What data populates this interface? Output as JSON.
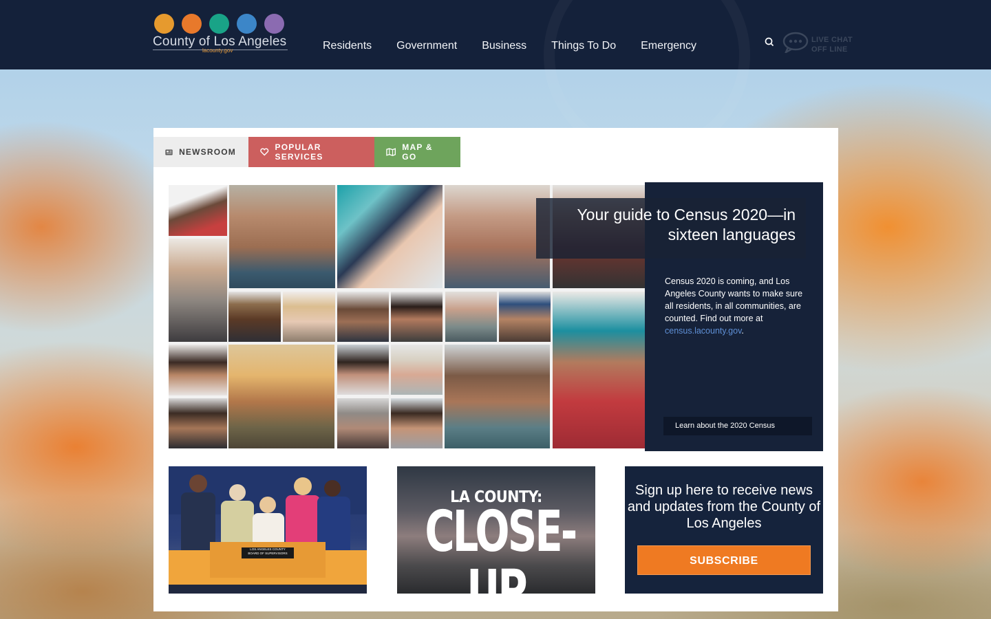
{
  "header": {
    "logo_title": "County of Los Angeles",
    "logo_sub": "lacounty.gov",
    "logo_icon_colors": [
      "#e69a2e",
      "#e8792b",
      "#19a387",
      "#3c86c8",
      "#8b6bb1"
    ],
    "nav": [
      {
        "label": "Residents"
      },
      {
        "label": "Government"
      },
      {
        "label": "Business"
      },
      {
        "label": "Things To Do"
      },
      {
        "label": "Emergency"
      }
    ],
    "chat_line1": "LIVE CHAT",
    "chat_line2": "OFF LINE"
  },
  "tabs": {
    "newsroom": "NEWSROOM",
    "popular": "POPULAR SERVICES",
    "map": "MAP & GO"
  },
  "feature": {
    "title": "Your guide to Census 2020—in sixteen languages",
    "body": "Census 2020 is coming, and Los Angeles County wants to make sure all residents, in all communities, are counted. Find out more at ",
    "link_text": "census.lacounty.gov",
    "body_end": ".",
    "button": "Learn about the 2020 Census",
    "slide_count": 4,
    "active_slide": 4
  },
  "cards": {
    "board_label_line1": "LOS ANGELES COUNTY",
    "board_label_line2": "BOARD OF SUPERVISORS",
    "closeup_small": "LA COUNTY:",
    "closeup_big": "CLOSE-UP",
    "subscribe_text": "Sign up here to receive news and updates from the County of Los Angeles",
    "subscribe_button": "SUBSCRIBE"
  },
  "colors": {
    "header_bg": "#14213a",
    "popular_tab": "#cc5f5e",
    "map_tab": "#6ea45c",
    "subscribe_button": "#ef7a22",
    "feature_bg": "#162239",
    "link": "#5f90d6"
  }
}
